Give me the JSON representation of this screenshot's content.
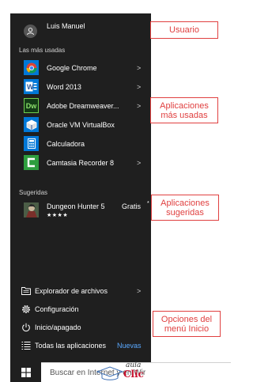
{
  "user": {
    "name": "Luis Manuel"
  },
  "most_used": {
    "header": "Las más usadas",
    "apps": [
      {
        "label": "Google Chrome",
        "icon": "chrome-icon",
        "has_submenu": true
      },
      {
        "label": "Word 2013",
        "icon": "word-icon",
        "has_submenu": true
      },
      {
        "label": "Adobe Dreamweaver...",
        "icon": "dreamweaver-icon",
        "has_submenu": true
      },
      {
        "label": "Oracle VM VirtualBox",
        "icon": "virtualbox-icon",
        "has_submenu": false
      },
      {
        "label": "Calculadora",
        "icon": "calculator-icon",
        "has_submenu": false
      },
      {
        "label": "Camtasia Recorder 8",
        "icon": "camtasia-icon",
        "has_submenu": true
      }
    ]
  },
  "suggested": {
    "header": "Sugeridas",
    "app": {
      "title": "Dungeon Hunter 5",
      "price": "Gratis",
      "rating": "★★★★",
      "stars_filled": 4,
      "stars_total": 5
    }
  },
  "bottom_menu": {
    "explorer": "Explorador de archivos",
    "settings": "Configuración",
    "power": "Inicio/apagado",
    "all_apps": "Todas las aplicaciones",
    "new_badge": "Nuevas"
  },
  "taskbar": {
    "search_placeholder": "Buscar en Internet y en Wir",
    "watermark": {
      "top": "aula",
      "bottom": "Clic"
    }
  },
  "callouts": {
    "user": "Usuario",
    "most_used_1": "Aplicaciones",
    "most_used_2": "más usadas",
    "suggested_1": "Aplicaciones",
    "suggested_2": "sugeridas",
    "options_1": "Opciones del",
    "options_2": "menú Inicio"
  },
  "colors": {
    "menu_bg": "#1f1f1f",
    "accent_blue": "#0078d7",
    "callout_red": "#e04040",
    "new_badge": "#5aa9ff"
  }
}
